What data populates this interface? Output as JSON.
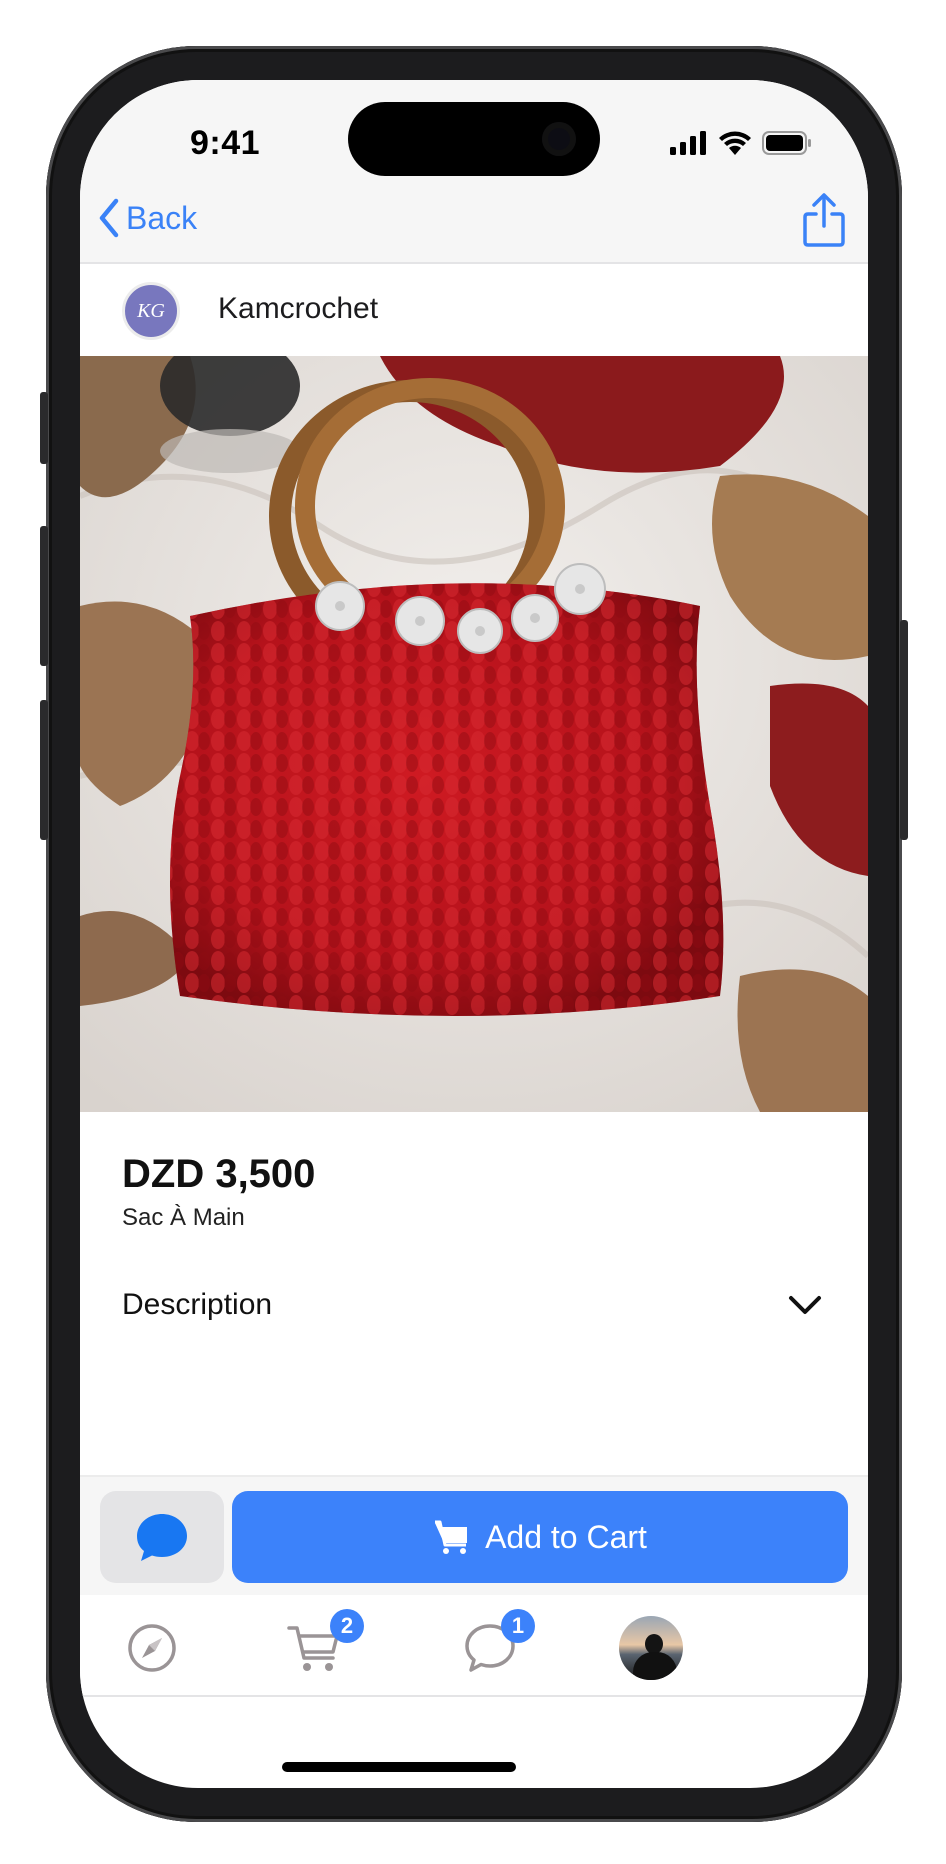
{
  "status_bar": {
    "time": "9:41",
    "icons": [
      "cellular-signal-icon",
      "wifi-icon",
      "battery-icon"
    ]
  },
  "nav": {
    "back_label": "Back",
    "back_icon": "chevron-left-icon",
    "share_icon": "share-icon"
  },
  "shop": {
    "name": "Kamcrochet",
    "avatar_monogram": "KG"
  },
  "product": {
    "image_alt": "Red crochet handbag with round wooden handles and white flower appliqués",
    "carousel_pages": 1,
    "carousel_active_index": 0,
    "price": "DZD 3,500",
    "title": "Sac À Main",
    "description_label": "Description",
    "description_expanded": false
  },
  "actions": {
    "chat_icon": "chat-bubble-icon",
    "add_to_cart_label": "Add to Cart",
    "add_to_cart_icon": "cart-icon"
  },
  "tab_bar": {
    "items": [
      {
        "name": "explore",
        "icon": "compass-icon",
        "badge": null
      },
      {
        "name": "cart",
        "icon": "cart-icon",
        "badge": "2"
      },
      {
        "name": "messages",
        "icon": "chat-bubble-icon",
        "badge": "1"
      },
      {
        "name": "profile",
        "icon": "avatar",
        "badge": null
      }
    ]
  },
  "colors": {
    "accent": "#3c82fa",
    "nav_tint": "#3a82f7",
    "page_dot": "#1877f2",
    "product_red": "#b5121b"
  }
}
